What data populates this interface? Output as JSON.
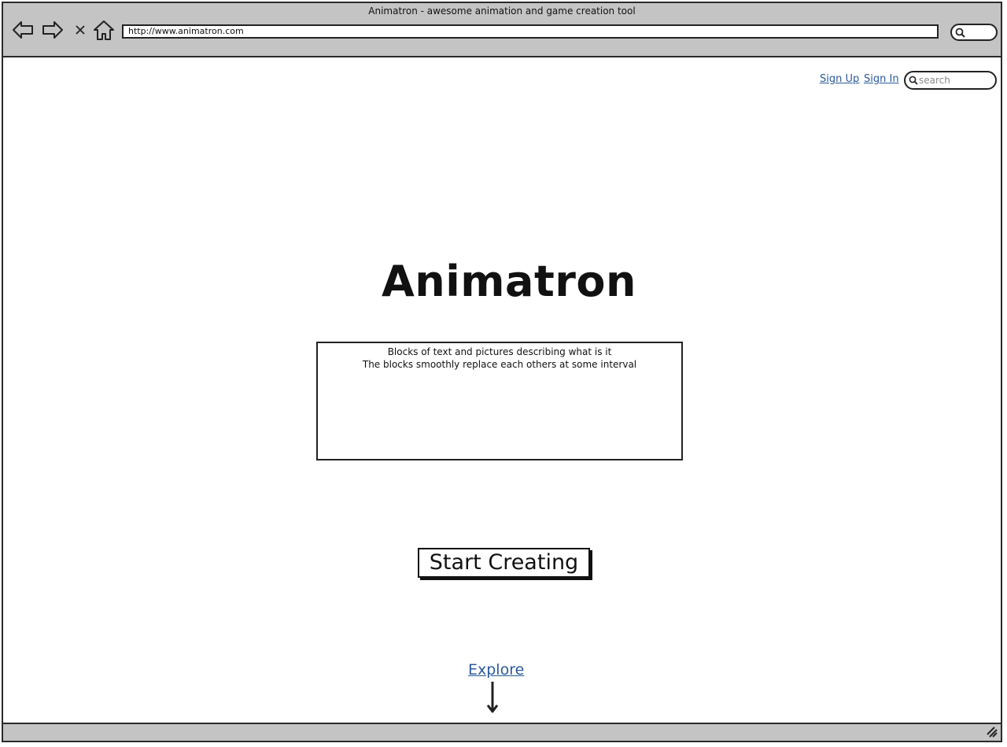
{
  "browser": {
    "window_title": "Animatron - awesome animation and game creation tool",
    "url": "http://www.animatron.com",
    "nav_icons": [
      "back-arrow-icon",
      "forward-arrow-icon",
      "close-icon",
      "home-icon"
    ],
    "search_icon": "search-icon"
  },
  "header": {
    "sign_up": "Sign Up",
    "sign_in": "Sign In",
    "search_placeholder": "search"
  },
  "hero": {
    "title": "Animatron",
    "carousel_lines": [
      "Blocks of text and pictures describing what is it",
      "The blocks smoothly replace each others at some interval"
    ],
    "cta_label": "Start Creating"
  },
  "footer": {
    "explore_label": "Explore",
    "explore_icon": "down-arrow-icon"
  },
  "colors": {
    "chrome_bg": "#c4c4c4",
    "link": "#2a5a9a",
    "border": "#222222"
  }
}
